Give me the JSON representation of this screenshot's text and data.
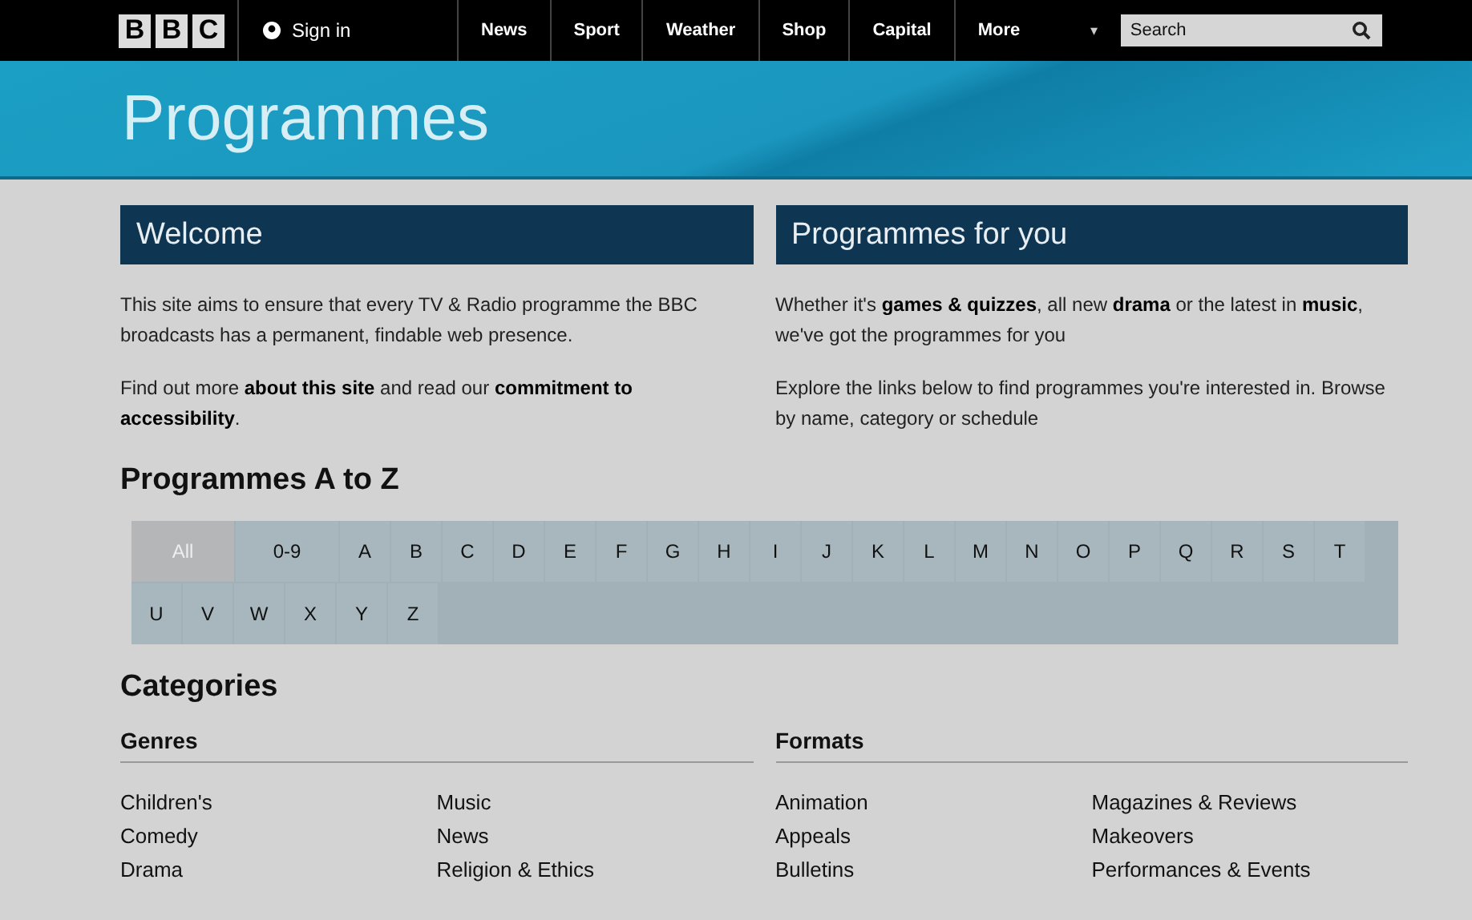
{
  "top_bar": {
    "logo": [
      "B",
      "B",
      "C"
    ],
    "sign_in": "Sign in",
    "nav": [
      "News",
      "Sport",
      "Weather",
      "Shop",
      "Capital",
      "More"
    ],
    "more_caret": "▾",
    "search": {
      "placeholder": "Search"
    }
  },
  "banner": {
    "title": "Programmes"
  },
  "panels": [
    {
      "heading": "Welcome",
      "paragraphs": [
        "This site aims to ensure that every TV & Radio programme the BBC broadcasts has a permanent, findable web presence.",
        "Find out more **about this site** and read our **commitment to accessibility**."
      ]
    },
    {
      "heading": "Programmes for you",
      "paragraphs": [
        "Whether it's **games & quizzes**, all new **drama** or the latest in **music**, we've got the programmes for you",
        "Explore the links below to find programmes you're interested in. Browse by name, category or schedule"
      ]
    }
  ],
  "a_to_z": {
    "heading": "Programmes A to Z",
    "letters": [
      {
        "label": "All",
        "selected": true
      },
      {
        "label": "0-9",
        "selected": false
      },
      {
        "label": "A",
        "selected": false
      },
      {
        "label": "B",
        "selected": false
      },
      {
        "label": "C",
        "selected": false
      },
      {
        "label": "D",
        "selected": false
      },
      {
        "label": "E",
        "selected": false
      },
      {
        "label": "F",
        "selected": false
      },
      {
        "label": "G",
        "selected": false
      },
      {
        "label": "H",
        "selected": false
      },
      {
        "label": "I",
        "selected": false
      },
      {
        "label": "J",
        "selected": false
      },
      {
        "label": "K",
        "selected": false
      },
      {
        "label": "L",
        "selected": false
      },
      {
        "label": "M",
        "selected": false
      },
      {
        "label": "N",
        "selected": false
      },
      {
        "label": "O",
        "selected": false
      },
      {
        "label": "P",
        "selected": false
      },
      {
        "label": "Q",
        "selected": false
      },
      {
        "label": "R",
        "selected": false
      },
      {
        "label": "S",
        "selected": false
      },
      {
        "label": "T",
        "selected": false
      },
      {
        "label": "U",
        "selected": false
      },
      {
        "label": "V",
        "selected": false
      },
      {
        "label": "W",
        "selected": false
      },
      {
        "label": "X",
        "selected": false
      },
      {
        "label": "Y",
        "selected": false
      },
      {
        "label": "Z",
        "selected": false
      }
    ]
  },
  "categories": {
    "heading": "Categories",
    "groups": [
      {
        "heading": "Genres",
        "columns": [
          [
            "Children's",
            "Comedy",
            "Drama"
          ],
          [
            "Music",
            "News",
            "Religion & Ethics"
          ]
        ]
      },
      {
        "heading": "Formats",
        "columns": [
          [
            "Animation",
            "Appeals",
            "Bulletins"
          ],
          [
            "Magazines & Reviews",
            "Makeovers",
            "Performances & Events"
          ]
        ]
      }
    ]
  }
}
